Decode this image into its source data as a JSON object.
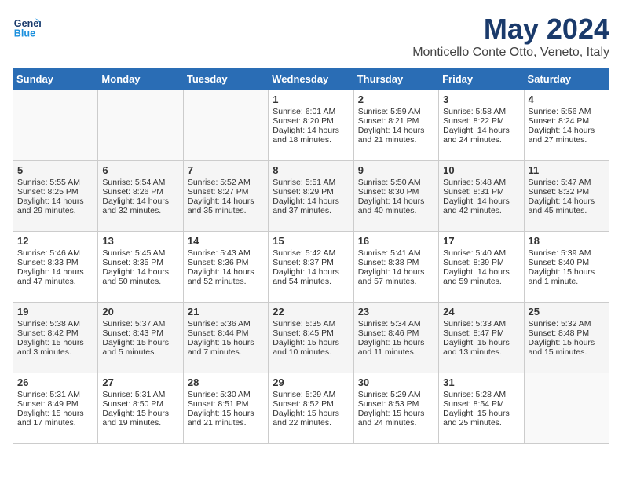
{
  "header": {
    "logo_line1": "General",
    "logo_line2": "Blue",
    "month_title": "May 2024",
    "location": "Monticello Conte Otto, Veneto, Italy"
  },
  "days_of_week": [
    "Sunday",
    "Monday",
    "Tuesday",
    "Wednesday",
    "Thursday",
    "Friday",
    "Saturday"
  ],
  "weeks": [
    [
      {
        "day": "",
        "info": ""
      },
      {
        "day": "",
        "info": ""
      },
      {
        "day": "",
        "info": ""
      },
      {
        "day": "1",
        "info": "Sunrise: 6:01 AM\nSunset: 8:20 PM\nDaylight: 14 hours and 18 minutes."
      },
      {
        "day": "2",
        "info": "Sunrise: 5:59 AM\nSunset: 8:21 PM\nDaylight: 14 hours and 21 minutes."
      },
      {
        "day": "3",
        "info": "Sunrise: 5:58 AM\nSunset: 8:22 PM\nDaylight: 14 hours and 24 minutes."
      },
      {
        "day": "4",
        "info": "Sunrise: 5:56 AM\nSunset: 8:24 PM\nDaylight: 14 hours and 27 minutes."
      }
    ],
    [
      {
        "day": "5",
        "info": "Sunrise: 5:55 AM\nSunset: 8:25 PM\nDaylight: 14 hours and 29 minutes."
      },
      {
        "day": "6",
        "info": "Sunrise: 5:54 AM\nSunset: 8:26 PM\nDaylight: 14 hours and 32 minutes."
      },
      {
        "day": "7",
        "info": "Sunrise: 5:52 AM\nSunset: 8:27 PM\nDaylight: 14 hours and 35 minutes."
      },
      {
        "day": "8",
        "info": "Sunrise: 5:51 AM\nSunset: 8:29 PM\nDaylight: 14 hours and 37 minutes."
      },
      {
        "day": "9",
        "info": "Sunrise: 5:50 AM\nSunset: 8:30 PM\nDaylight: 14 hours and 40 minutes."
      },
      {
        "day": "10",
        "info": "Sunrise: 5:48 AM\nSunset: 8:31 PM\nDaylight: 14 hours and 42 minutes."
      },
      {
        "day": "11",
        "info": "Sunrise: 5:47 AM\nSunset: 8:32 PM\nDaylight: 14 hours and 45 minutes."
      }
    ],
    [
      {
        "day": "12",
        "info": "Sunrise: 5:46 AM\nSunset: 8:33 PM\nDaylight: 14 hours and 47 minutes."
      },
      {
        "day": "13",
        "info": "Sunrise: 5:45 AM\nSunset: 8:35 PM\nDaylight: 14 hours and 50 minutes."
      },
      {
        "day": "14",
        "info": "Sunrise: 5:43 AM\nSunset: 8:36 PM\nDaylight: 14 hours and 52 minutes."
      },
      {
        "day": "15",
        "info": "Sunrise: 5:42 AM\nSunset: 8:37 PM\nDaylight: 14 hours and 54 minutes."
      },
      {
        "day": "16",
        "info": "Sunrise: 5:41 AM\nSunset: 8:38 PM\nDaylight: 14 hours and 57 minutes."
      },
      {
        "day": "17",
        "info": "Sunrise: 5:40 AM\nSunset: 8:39 PM\nDaylight: 14 hours and 59 minutes."
      },
      {
        "day": "18",
        "info": "Sunrise: 5:39 AM\nSunset: 8:40 PM\nDaylight: 15 hours and 1 minute."
      }
    ],
    [
      {
        "day": "19",
        "info": "Sunrise: 5:38 AM\nSunset: 8:42 PM\nDaylight: 15 hours and 3 minutes."
      },
      {
        "day": "20",
        "info": "Sunrise: 5:37 AM\nSunset: 8:43 PM\nDaylight: 15 hours and 5 minutes."
      },
      {
        "day": "21",
        "info": "Sunrise: 5:36 AM\nSunset: 8:44 PM\nDaylight: 15 hours and 7 minutes."
      },
      {
        "day": "22",
        "info": "Sunrise: 5:35 AM\nSunset: 8:45 PM\nDaylight: 15 hours and 10 minutes."
      },
      {
        "day": "23",
        "info": "Sunrise: 5:34 AM\nSunset: 8:46 PM\nDaylight: 15 hours and 11 minutes."
      },
      {
        "day": "24",
        "info": "Sunrise: 5:33 AM\nSunset: 8:47 PM\nDaylight: 15 hours and 13 minutes."
      },
      {
        "day": "25",
        "info": "Sunrise: 5:32 AM\nSunset: 8:48 PM\nDaylight: 15 hours and 15 minutes."
      }
    ],
    [
      {
        "day": "26",
        "info": "Sunrise: 5:31 AM\nSunset: 8:49 PM\nDaylight: 15 hours and 17 minutes."
      },
      {
        "day": "27",
        "info": "Sunrise: 5:31 AM\nSunset: 8:50 PM\nDaylight: 15 hours and 19 minutes."
      },
      {
        "day": "28",
        "info": "Sunrise: 5:30 AM\nSunset: 8:51 PM\nDaylight: 15 hours and 21 minutes."
      },
      {
        "day": "29",
        "info": "Sunrise: 5:29 AM\nSunset: 8:52 PM\nDaylight: 15 hours and 22 minutes."
      },
      {
        "day": "30",
        "info": "Sunrise: 5:29 AM\nSunset: 8:53 PM\nDaylight: 15 hours and 24 minutes."
      },
      {
        "day": "31",
        "info": "Sunrise: 5:28 AM\nSunset: 8:54 PM\nDaylight: 15 hours and 25 minutes."
      },
      {
        "day": "",
        "info": ""
      }
    ]
  ]
}
